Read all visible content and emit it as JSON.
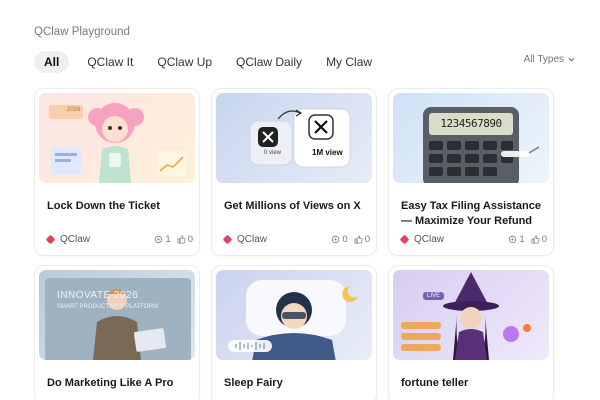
{
  "header": {
    "title": "QClaw Playground"
  },
  "tabs": [
    {
      "label": "All"
    },
    {
      "label": "QClaw It"
    },
    {
      "label": "QClaw Up"
    },
    {
      "label": "QClaw Daily"
    },
    {
      "label": "My Claw"
    }
  ],
  "filter": {
    "label": "All Types"
  },
  "cards": [
    {
      "title": "Lock Down the Ticket",
      "author": "QClaw",
      "views": "1",
      "likes": "0",
      "thumb_text": "2026"
    },
    {
      "title": "Get Millions of Views on X",
      "author": "QClaw",
      "views": "0",
      "likes": "0",
      "thumb_text_a": "0 view",
      "thumb_text_b": "1M view"
    },
    {
      "title": "Easy Tax Filing Assistance — Maximize Your Refund",
      "author": "QClaw",
      "views": "1",
      "likes": "0",
      "thumb_text": "1234567890"
    },
    {
      "title": "Do Marketing Like A Pro",
      "thumb_text_a": "INNOVATE 2026",
      "thumb_text_b": "SMART PRODUCTIVITY PLATFORM"
    },
    {
      "title": "Sleep Fairy"
    },
    {
      "title": "fortune teller",
      "thumb_text": "LIVE"
    }
  ],
  "colors": {
    "brand": "#e0445a",
    "active_tab_bg": "#efefef"
  }
}
